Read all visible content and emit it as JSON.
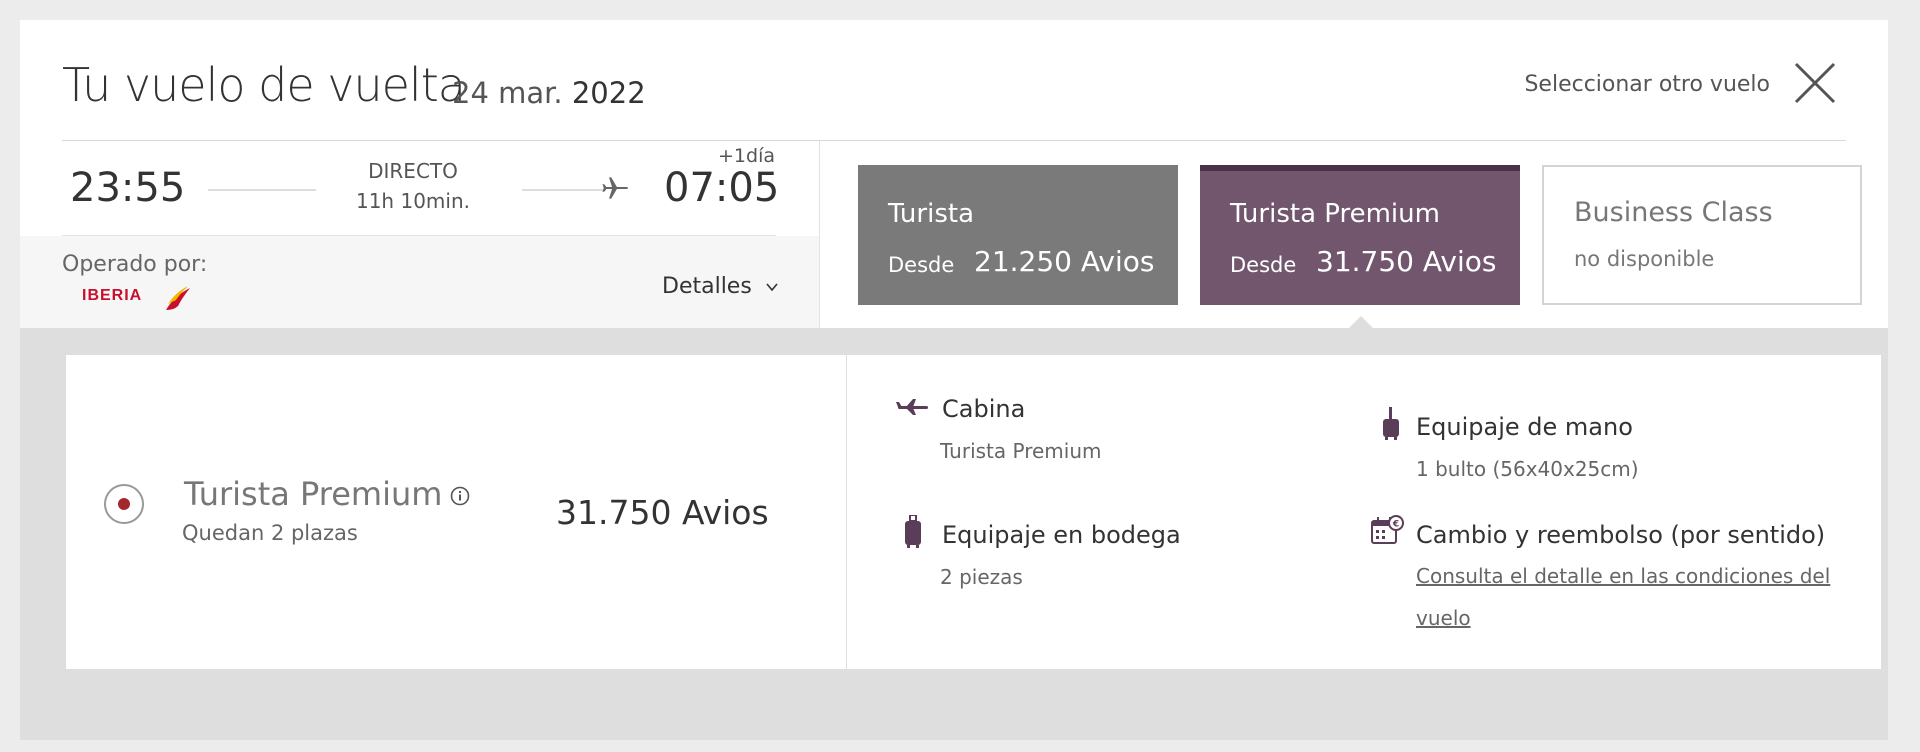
{
  "header": {
    "title": "Tu vuelo de vuelta",
    "date_day_month": "24 mar.",
    "date_year": "2022",
    "other_flight_label": "Seleccionar otro vuelo"
  },
  "flight": {
    "departure_time": "23:55",
    "type": "DIRECTO",
    "duration": "11h 10min.",
    "plus_day": "+1día",
    "arrival_time": "07:05",
    "operated_by_label": "Operado por:",
    "operator": "IBERIA",
    "details_label": "Detalles"
  },
  "fares": {
    "turista": {
      "name": "Turista",
      "from_label": "Desde",
      "price": "21.250 Avios"
    },
    "premium": {
      "name": "Turista Premium",
      "from_label": "Desde",
      "price": "31.750 Avios"
    },
    "business": {
      "name": "Business Class",
      "status": "no disponible"
    }
  },
  "selected": {
    "name": "Turista Premium",
    "seats_left": "Quedan 2 plazas",
    "price": "31.750 Avios"
  },
  "features": {
    "cabin_title": "Cabina",
    "cabin_value": "Turista Premium",
    "hand_luggage_title": "Equipaje de mano",
    "hand_luggage_value": "1 bulto (56x40x25cm)",
    "hold_luggage_title": "Equipaje en bodega",
    "hold_luggage_value": "2 piezas",
    "change_title": "Cambio y reembolso (por sentido)",
    "change_link": "Consulta el detalle en las condiciones del vuelo"
  },
  "colors": {
    "turista_tab": "#7a7a7a",
    "premium_tab": "#71566e",
    "accent_red": "#a3282c"
  }
}
